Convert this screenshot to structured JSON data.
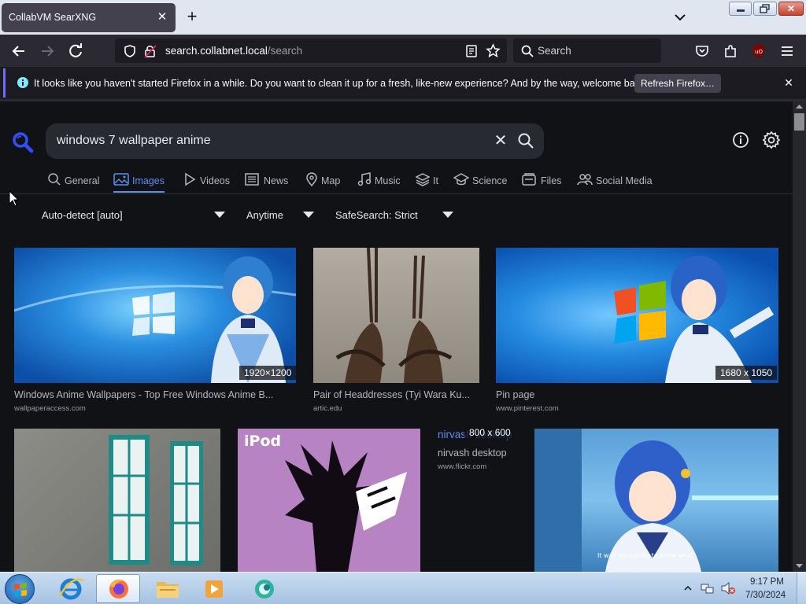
{
  "browser": {
    "tab_title": "CollabVM SearXNG",
    "tab_close": "✕",
    "new_tab": "+",
    "url_host": "search.collabnet.local",
    "url_path": "/search",
    "search_placeholder": "Search",
    "win_close": "✕"
  },
  "notification": {
    "text": "It looks like you haven't started Firefox in a while. Do you want to clean it up for a fresh, like-new experience? And by the way, welcome back!",
    "button": "Refresh Firefox…",
    "close": "✕"
  },
  "search": {
    "query": "windows 7 wallpaper anime",
    "clear": "✕"
  },
  "categories": [
    {
      "label": "General",
      "icon": "search-icon"
    },
    {
      "label": "Images",
      "icon": "image-icon",
      "active": true
    },
    {
      "label": "Videos",
      "icon": "play-icon"
    },
    {
      "label": "News",
      "icon": "newspaper-icon"
    },
    {
      "label": "Map",
      "icon": "map-pin-icon"
    },
    {
      "label": "Music",
      "icon": "music-note-icon"
    },
    {
      "label": "It",
      "icon": "layers-icon"
    },
    {
      "label": "Science",
      "icon": "graduation-cap-icon"
    },
    {
      "label": "Files",
      "icon": "files-icon"
    },
    {
      "label": "Social Media",
      "icon": "people-icon"
    }
  ],
  "filters": {
    "language": "Auto-detect [auto]",
    "time": "Anytime",
    "safesearch": "SafeSearch: Strict"
  },
  "results": [
    {
      "title": "Windows Anime Wallpapers - Top Free Windows Anime B...",
      "source": "wallpaperaccess.com",
      "dimensions": "1920×1200"
    },
    {
      "title": "Pair of Headdresses (Tyi Wara Ku...",
      "source": "artic.edu",
      "dimensions": ""
    },
    {
      "title": "Pin page",
      "source": "www.pinterest.com",
      "dimensions": "1680 x 1050"
    },
    {
      "title": "",
      "source": "",
      "dimensions": ""
    },
    {
      "title": "",
      "source": "",
      "dimensions": ""
    },
    {
      "title": "nirvash desktop",
      "source": "www.flickr.com",
      "dimensions": "800 x 600",
      "alt_text": "nirvash desktop"
    },
    {
      "title": "",
      "source": "",
      "dimensions": ""
    }
  ],
  "taskbar": {
    "time": "9:17 PM",
    "date": "7/30/2024"
  },
  "colors": {
    "accent": "#5c8ff0",
    "page_bg": "#111216",
    "chrome_bg": "#2b2a33",
    "notice_accent": "#6e6dfc"
  }
}
